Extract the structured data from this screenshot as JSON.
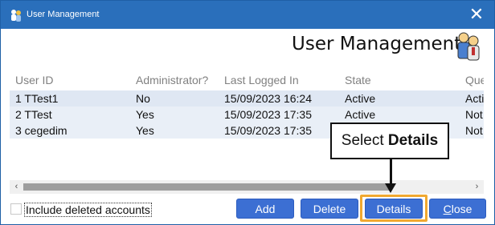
{
  "window": {
    "title": "User Management",
    "close_glyph": "✕"
  },
  "header": {
    "title": "User Management",
    "icon": "users-icon"
  },
  "grid": {
    "columns": [
      "User ID",
      "Administrator?",
      "Last Logged In",
      "State",
      "Que"
    ],
    "rows": [
      [
        "1 TTest1",
        "No",
        "15/09/2023 16:24",
        "Active",
        "Activ"
      ],
      [
        "2 TTest",
        "Yes",
        "15/09/2023 17:35",
        "Active",
        "Not"
      ],
      [
        "3 cegedim",
        "Yes",
        "15/09/2023 17:35",
        "",
        "Not"
      ]
    ]
  },
  "scrollbar": {
    "left_glyph": "‹",
    "right_glyph": "›"
  },
  "options": {
    "include_deleted_label": "Include deleted accounts"
  },
  "buttons": {
    "add": "Add",
    "delete": "Delete",
    "details": "Details",
    "close_underlined": "C",
    "close_rest": "lose"
  },
  "annotation": {
    "prefix": "Select ",
    "bold": "Details",
    "highlight_color": "#f0a830"
  },
  "colors": {
    "titlebar": "#2a6fbb",
    "button": "#3c6fd3",
    "selected_row": "#dfe7f3"
  }
}
